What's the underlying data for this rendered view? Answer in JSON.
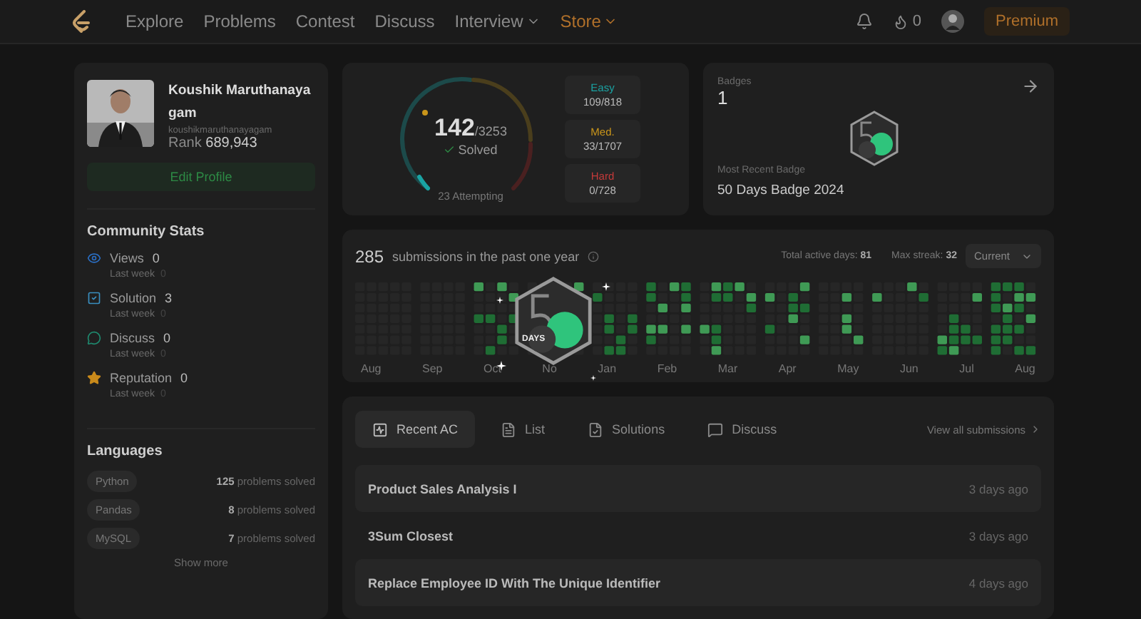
{
  "nav": {
    "links": [
      {
        "label": "Explore",
        "kind": "link"
      },
      {
        "label": "Problems",
        "kind": "link"
      },
      {
        "label": "Contest",
        "kind": "link"
      },
      {
        "label": "Discuss",
        "kind": "link"
      },
      {
        "label": "Interview",
        "kind": "dropdown"
      },
      {
        "label": "Store",
        "kind": "store"
      }
    ],
    "streak": "0",
    "premium": "Premium"
  },
  "profile": {
    "name": "Koushik Maruthanayagam",
    "username": "koushikmaruthanayagam",
    "rank_label": "Rank",
    "rank": "689,943",
    "edit": "Edit Profile"
  },
  "community": {
    "title": "Community Stats",
    "items": [
      {
        "kind": "views",
        "label": "Views",
        "value": "0",
        "sub": "Last week",
        "sub_value": "0"
      },
      {
        "kind": "solution",
        "label": "Solution",
        "value": "3",
        "sub": "Last week",
        "sub_value": "0"
      },
      {
        "kind": "discuss",
        "label": "Discuss",
        "value": "0",
        "sub": "Last week",
        "sub_value": "0"
      },
      {
        "kind": "reputation",
        "label": "Reputation",
        "value": "0",
        "sub": "Last week",
        "sub_value": "0"
      }
    ]
  },
  "languages": {
    "title": "Languages",
    "items": [
      {
        "name": "Python",
        "count": "125",
        "suffix": "problems solved"
      },
      {
        "name": "Pandas",
        "count": "8",
        "suffix": "problems solved"
      },
      {
        "name": "MySQL",
        "count": "7",
        "suffix": "problems solved"
      }
    ],
    "show_more": "Show more"
  },
  "solved": {
    "count": "142",
    "total": "/3253",
    "label": "Solved",
    "attempting": "23 Attempting",
    "difficulties": [
      {
        "kind": "easy",
        "label": "Easy",
        "value": "109/818"
      },
      {
        "kind": "medium",
        "label": "Med.",
        "value": "33/1707"
      },
      {
        "kind": "hard",
        "label": "Hard",
        "value": "0/728"
      }
    ]
  },
  "badges": {
    "title": "Badges",
    "count": "1",
    "recent_label": "Most Recent Badge",
    "recent": "50 Days Badge 2024"
  },
  "calendar": {
    "count": "285",
    "text": "submissions in the past one year",
    "active_label": "Total active days:",
    "active": "81",
    "streak_label": "Max streak:",
    "streak": "32",
    "select": "Current",
    "months": [
      "Aug",
      "Sep",
      "Oct",
      "No",
      "Jan",
      "Feb",
      "Mar",
      "Apr",
      "May",
      "Jun",
      "Jul",
      "Aug"
    ]
  },
  "popup_badge": {
    "text": "DAYS"
  },
  "activity": {
    "tabs": [
      {
        "label": "Recent AC",
        "kind": "recent",
        "selected": true
      },
      {
        "label": "List",
        "kind": "list",
        "selected": false
      },
      {
        "label": "Solutions",
        "kind": "solutions",
        "selected": false
      },
      {
        "label": "Discuss",
        "kind": "discuss",
        "selected": false
      }
    ],
    "view_all": "View all submissions",
    "rows": [
      {
        "title": "Product Sales Analysis I",
        "time": "3 days ago"
      },
      {
        "title": "3Sum Closest",
        "time": "3 days ago"
      },
      {
        "title": "Replace Employee ID With The Unique Identifier",
        "time": "4 days ago"
      }
    ]
  }
}
